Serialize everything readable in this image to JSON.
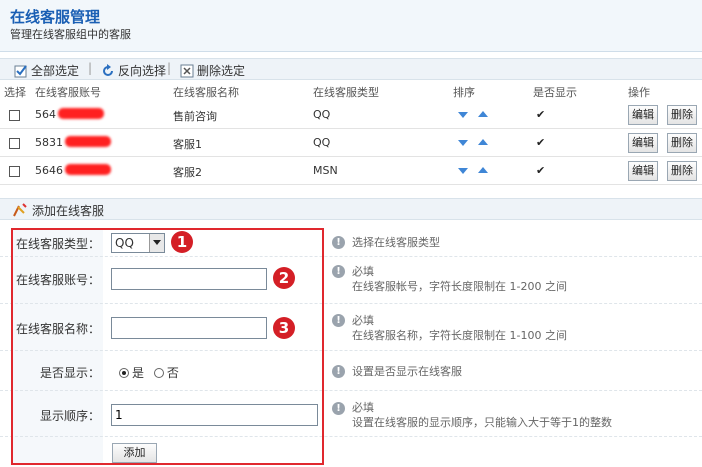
{
  "header": {
    "title": "在线客服管理",
    "subtitle": "管理在线客服组中的客服"
  },
  "toolbar": {
    "select_all": "全部选定",
    "invert": "反向选择",
    "delete_selected": "删除选定"
  },
  "table": {
    "columns": [
      "选择",
      "在线客服账号",
      "在线客服名称",
      "在线客服类型",
      "排序",
      "是否显示",
      "操作"
    ],
    "rows": [
      {
        "account": "564",
        "name": "售前咨询",
        "type": "QQ",
        "shown": "✔"
      },
      {
        "account": "5831",
        "name": "客服1",
        "type": "QQ",
        "shown": "✔"
      },
      {
        "account": "5646",
        "name": "客服2",
        "type": "MSN",
        "shown": "✔"
      }
    ],
    "edit_label": "编辑",
    "delete_label": "删除"
  },
  "add_section": {
    "title": "添加在线客服"
  },
  "form": {
    "type_label": "在线客服类型：",
    "type_value": "QQ",
    "type_hint": "选择在线客服类型",
    "account_label": "在线客服账号：",
    "account_value": "",
    "account_hint_1": "必填",
    "account_hint_2": "在线客服帐号，字符长度限制在  1-200 之间",
    "name_label": "在线客服名称：",
    "name_value": "",
    "name_hint_1": "必填",
    "name_hint_2": "在线客服名称，字符长度限制在  1-100 之间",
    "show_label": "是否显示：",
    "show_yes": "是",
    "show_no": "否",
    "show_hint": "设置是否显示在线客服",
    "order_label": "显示顺序：",
    "order_value": "1",
    "order_hint_1": "必填",
    "order_hint_2": "设置在线客服的显示顺序，只能输入大于等于1的整数",
    "submit_label": "添加"
  },
  "annotations": {
    "one": "1",
    "two": "2",
    "three": "3"
  }
}
